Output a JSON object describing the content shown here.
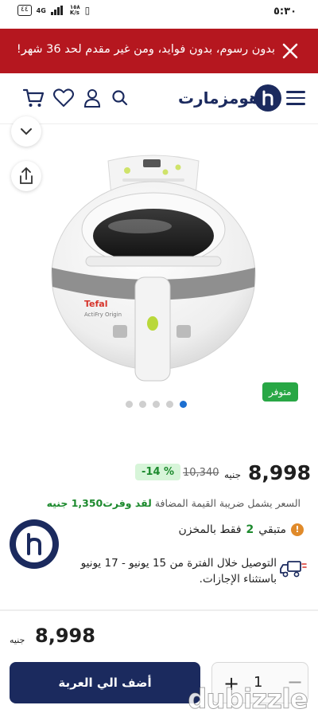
{
  "status_bar": {
    "time": "٥:٣٠",
    "battery": "٤٤",
    "network": "4G",
    "speed_top": "١٥٨",
    "speed_bottom": "K/s"
  },
  "promo": {
    "text": "بدون رسوم، بدون فوايد، ومن غير مقدم لحد 36 شهر!",
    "close_icon": "close-icon"
  },
  "header": {
    "logo_text": "هومزمارت",
    "icons": [
      "menu-icon",
      "search-icon",
      "user-icon",
      "heart-icon",
      "cart-icon"
    ]
  },
  "gallery": {
    "stock_badge": "متوفر",
    "slide_count": 5,
    "active_slide": 5,
    "brand_on_product": "Tefal",
    "model_on_product": "ActiFry Origin"
  },
  "price": {
    "current": "8,998",
    "currency": "جنيه",
    "old": "10,340",
    "discount": "-14 %"
  },
  "vat": {
    "note": "السعر يشمل ضريبة القيمة المضافة",
    "saving": "لقد وفرت1,350 جنيه"
  },
  "stock": {
    "prefix": "متبقي",
    "qty": "2",
    "suffix": "فقط بالمخزن"
  },
  "delivery": {
    "text": "التوصيل خلال الفترة من 15 يونيو - 17 يونيو باستثناء الإجازات."
  },
  "bottom_bar": {
    "price": "8,998",
    "currency": "جنيه",
    "add_to_cart": "أضف الي العربة",
    "quantity": "1",
    "plus": "+",
    "minus": "−"
  },
  "watermark": "dubizzle",
  "colors": {
    "brand_navy": "#1b2a5e",
    "promo_red": "#b5171f",
    "success_green": "#1d8a2e",
    "badge_green": "#28a745",
    "active_dot": "#1d6fd1"
  }
}
